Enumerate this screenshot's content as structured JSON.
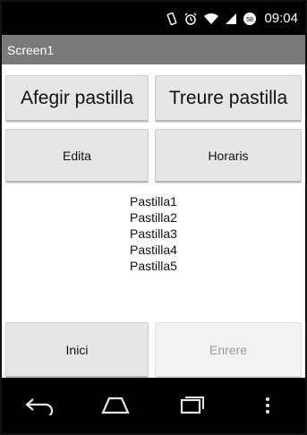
{
  "status_bar": {
    "time": "09:04",
    "icons": [
      "vibrate-icon",
      "alarm-icon",
      "wifi-icon",
      "signal-icon",
      "battery-icon"
    ],
    "battery_level": "58"
  },
  "app": {
    "screen_title": "Screen1"
  },
  "buttons": {
    "add_pill": "Afegir pastilla",
    "remove_pill": "Treure pastilla",
    "edit": "Edita",
    "schedules": "Horaris",
    "home": "Inici",
    "back": "Enrere"
  },
  "pills": [
    "Pastilla1",
    "Pastilla2",
    "Pastilla3",
    "Pastilla4",
    "Pastilla5"
  ],
  "nav_bar": {
    "icons": [
      "back-icon",
      "home-icon",
      "recent-apps-icon",
      "menu-icon"
    ]
  },
  "colors": {
    "title_bar": "#7a7a7a",
    "button_bg": "#e6e6e6",
    "disabled_text": "#9a9a9a"
  }
}
